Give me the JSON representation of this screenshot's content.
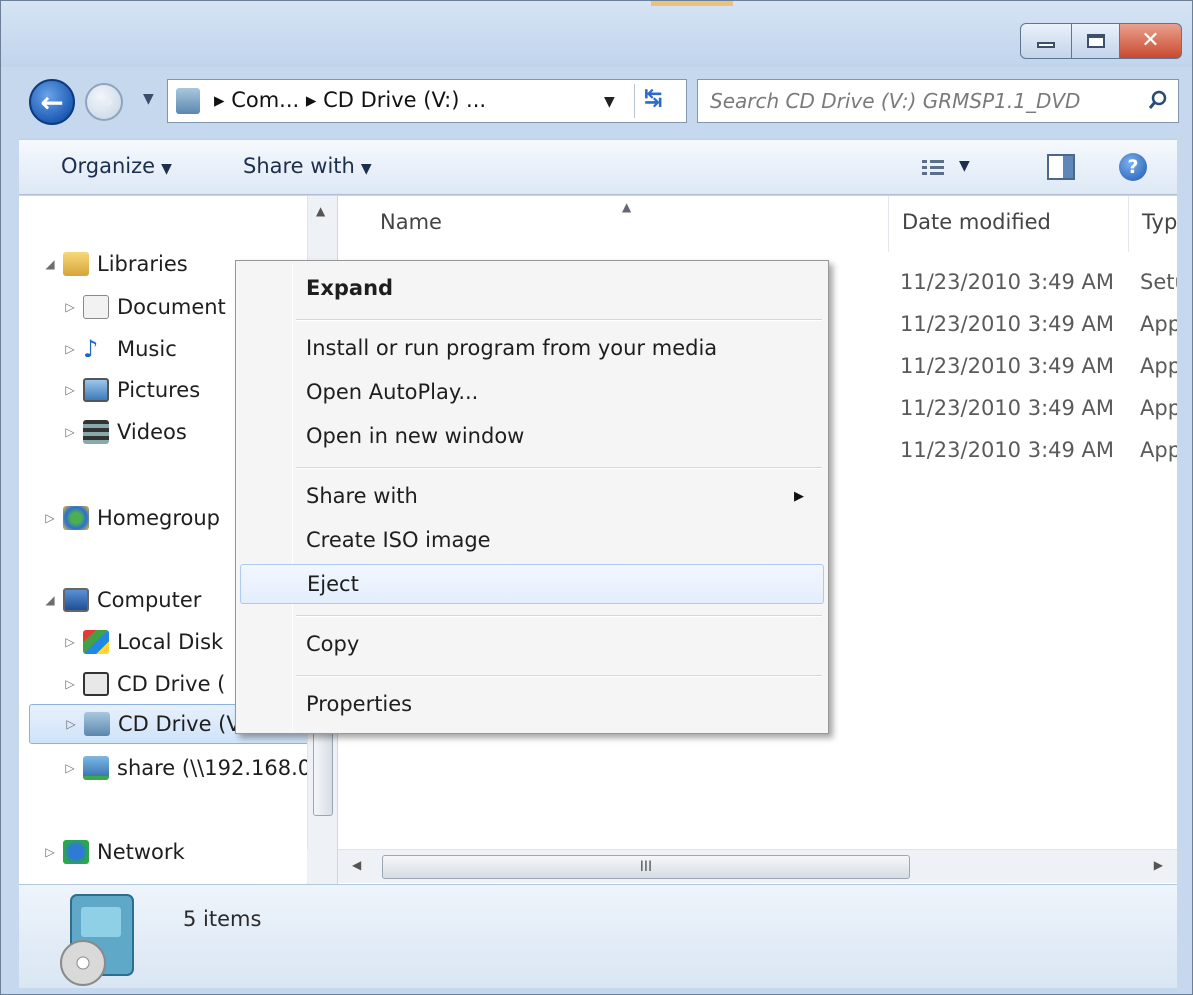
{
  "window": {
    "title_buttons": {
      "minimize": "minimize-icon",
      "maximize": "maximize-icon",
      "close": "close-icon",
      "close_glyph": "✕"
    }
  },
  "address": {
    "crumbs": "▸ Com...  ▸ CD Drive (V:) ...",
    "search_placeholder": "Search CD Drive (V:) GRMSP1.1_DVD"
  },
  "toolbar": {
    "organize": "Organize",
    "share_with": "Share with"
  },
  "nav": {
    "items": [
      {
        "label": "Libraries",
        "expander": "◢"
      },
      {
        "label": "Document",
        "expander": "▷"
      },
      {
        "label": "Music",
        "expander": "▷"
      },
      {
        "label": "Pictures",
        "expander": "▷"
      },
      {
        "label": "Videos",
        "expander": "▷"
      },
      {
        "label": "Homegroup",
        "expander": "▷"
      },
      {
        "label": "Computer",
        "expander": "◢"
      },
      {
        "label": "Local Disk",
        "expander": "▷"
      },
      {
        "label": "CD Drive (",
        "expander": "▷"
      },
      {
        "label": "CD Drive (V:) GR",
        "expander": "▷"
      },
      {
        "label": "share (\\\\192.168.0",
        "expander": "▷"
      },
      {
        "label": "Network",
        "expander": "▷"
      }
    ]
  },
  "columns": {
    "name": "Name",
    "date_modified": "Date modified",
    "type": "Typ"
  },
  "rows": [
    {
      "date": "11/23/2010 3:49 AM",
      "type": "Setu"
    },
    {
      "date": "11/23/2010 3:49 AM",
      "type": "App"
    },
    {
      "date": "11/23/2010 3:49 AM",
      "type": "App"
    },
    {
      "date": "11/23/2010 3:49 AM",
      "type": "App"
    },
    {
      "date": "11/23/2010 3:49 AM",
      "type": "App"
    }
  ],
  "context_menu": {
    "items": [
      {
        "label": "Expand",
        "bold": true
      },
      {
        "label": "Install or run program from your media"
      },
      {
        "label": "Open AutoPlay..."
      },
      {
        "label": "Open in new window"
      },
      {
        "label": "Share with",
        "submenu": true
      },
      {
        "label": "Create ISO image"
      },
      {
        "label": "Eject",
        "hover": true
      },
      {
        "label": "Copy"
      },
      {
        "label": "Properties"
      }
    ]
  },
  "details": {
    "count": "5 items"
  },
  "scrollbar": {
    "grip": "III"
  }
}
